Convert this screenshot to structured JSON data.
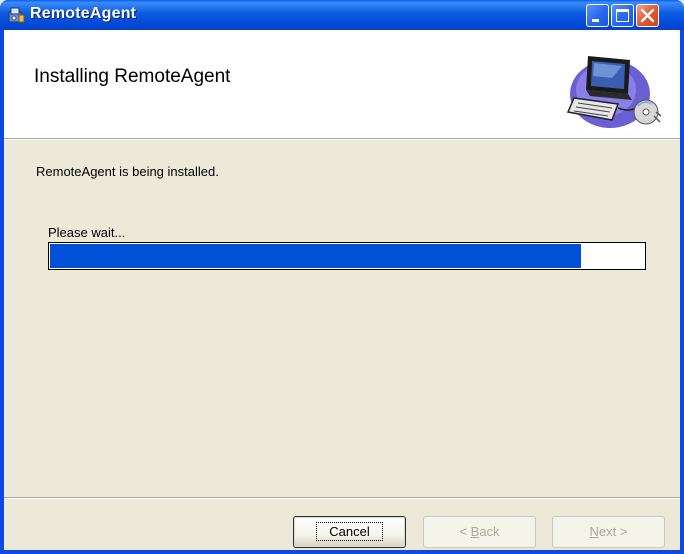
{
  "window": {
    "title": "RemoteAgent",
    "controls": [
      "minimize",
      "maximize",
      "close"
    ]
  },
  "banner": {
    "title": "Installing RemoteAgent",
    "graphic_icon": "computer-cd-icon"
  },
  "body": {
    "status": "RemoteAgent is being installed.",
    "wait_label": "Please wait...",
    "progress": 0.895
  },
  "buttons": {
    "cancel": "Cancel",
    "back_prefix": "< ",
    "back_key": "B",
    "back_rest": "ack",
    "next_key": "N",
    "next_rest": "ext >"
  },
  "colors": {
    "titlebar": "#0b5be0",
    "progress_fill": "#0050d8",
    "dialog_bg": "#ece9d8"
  }
}
